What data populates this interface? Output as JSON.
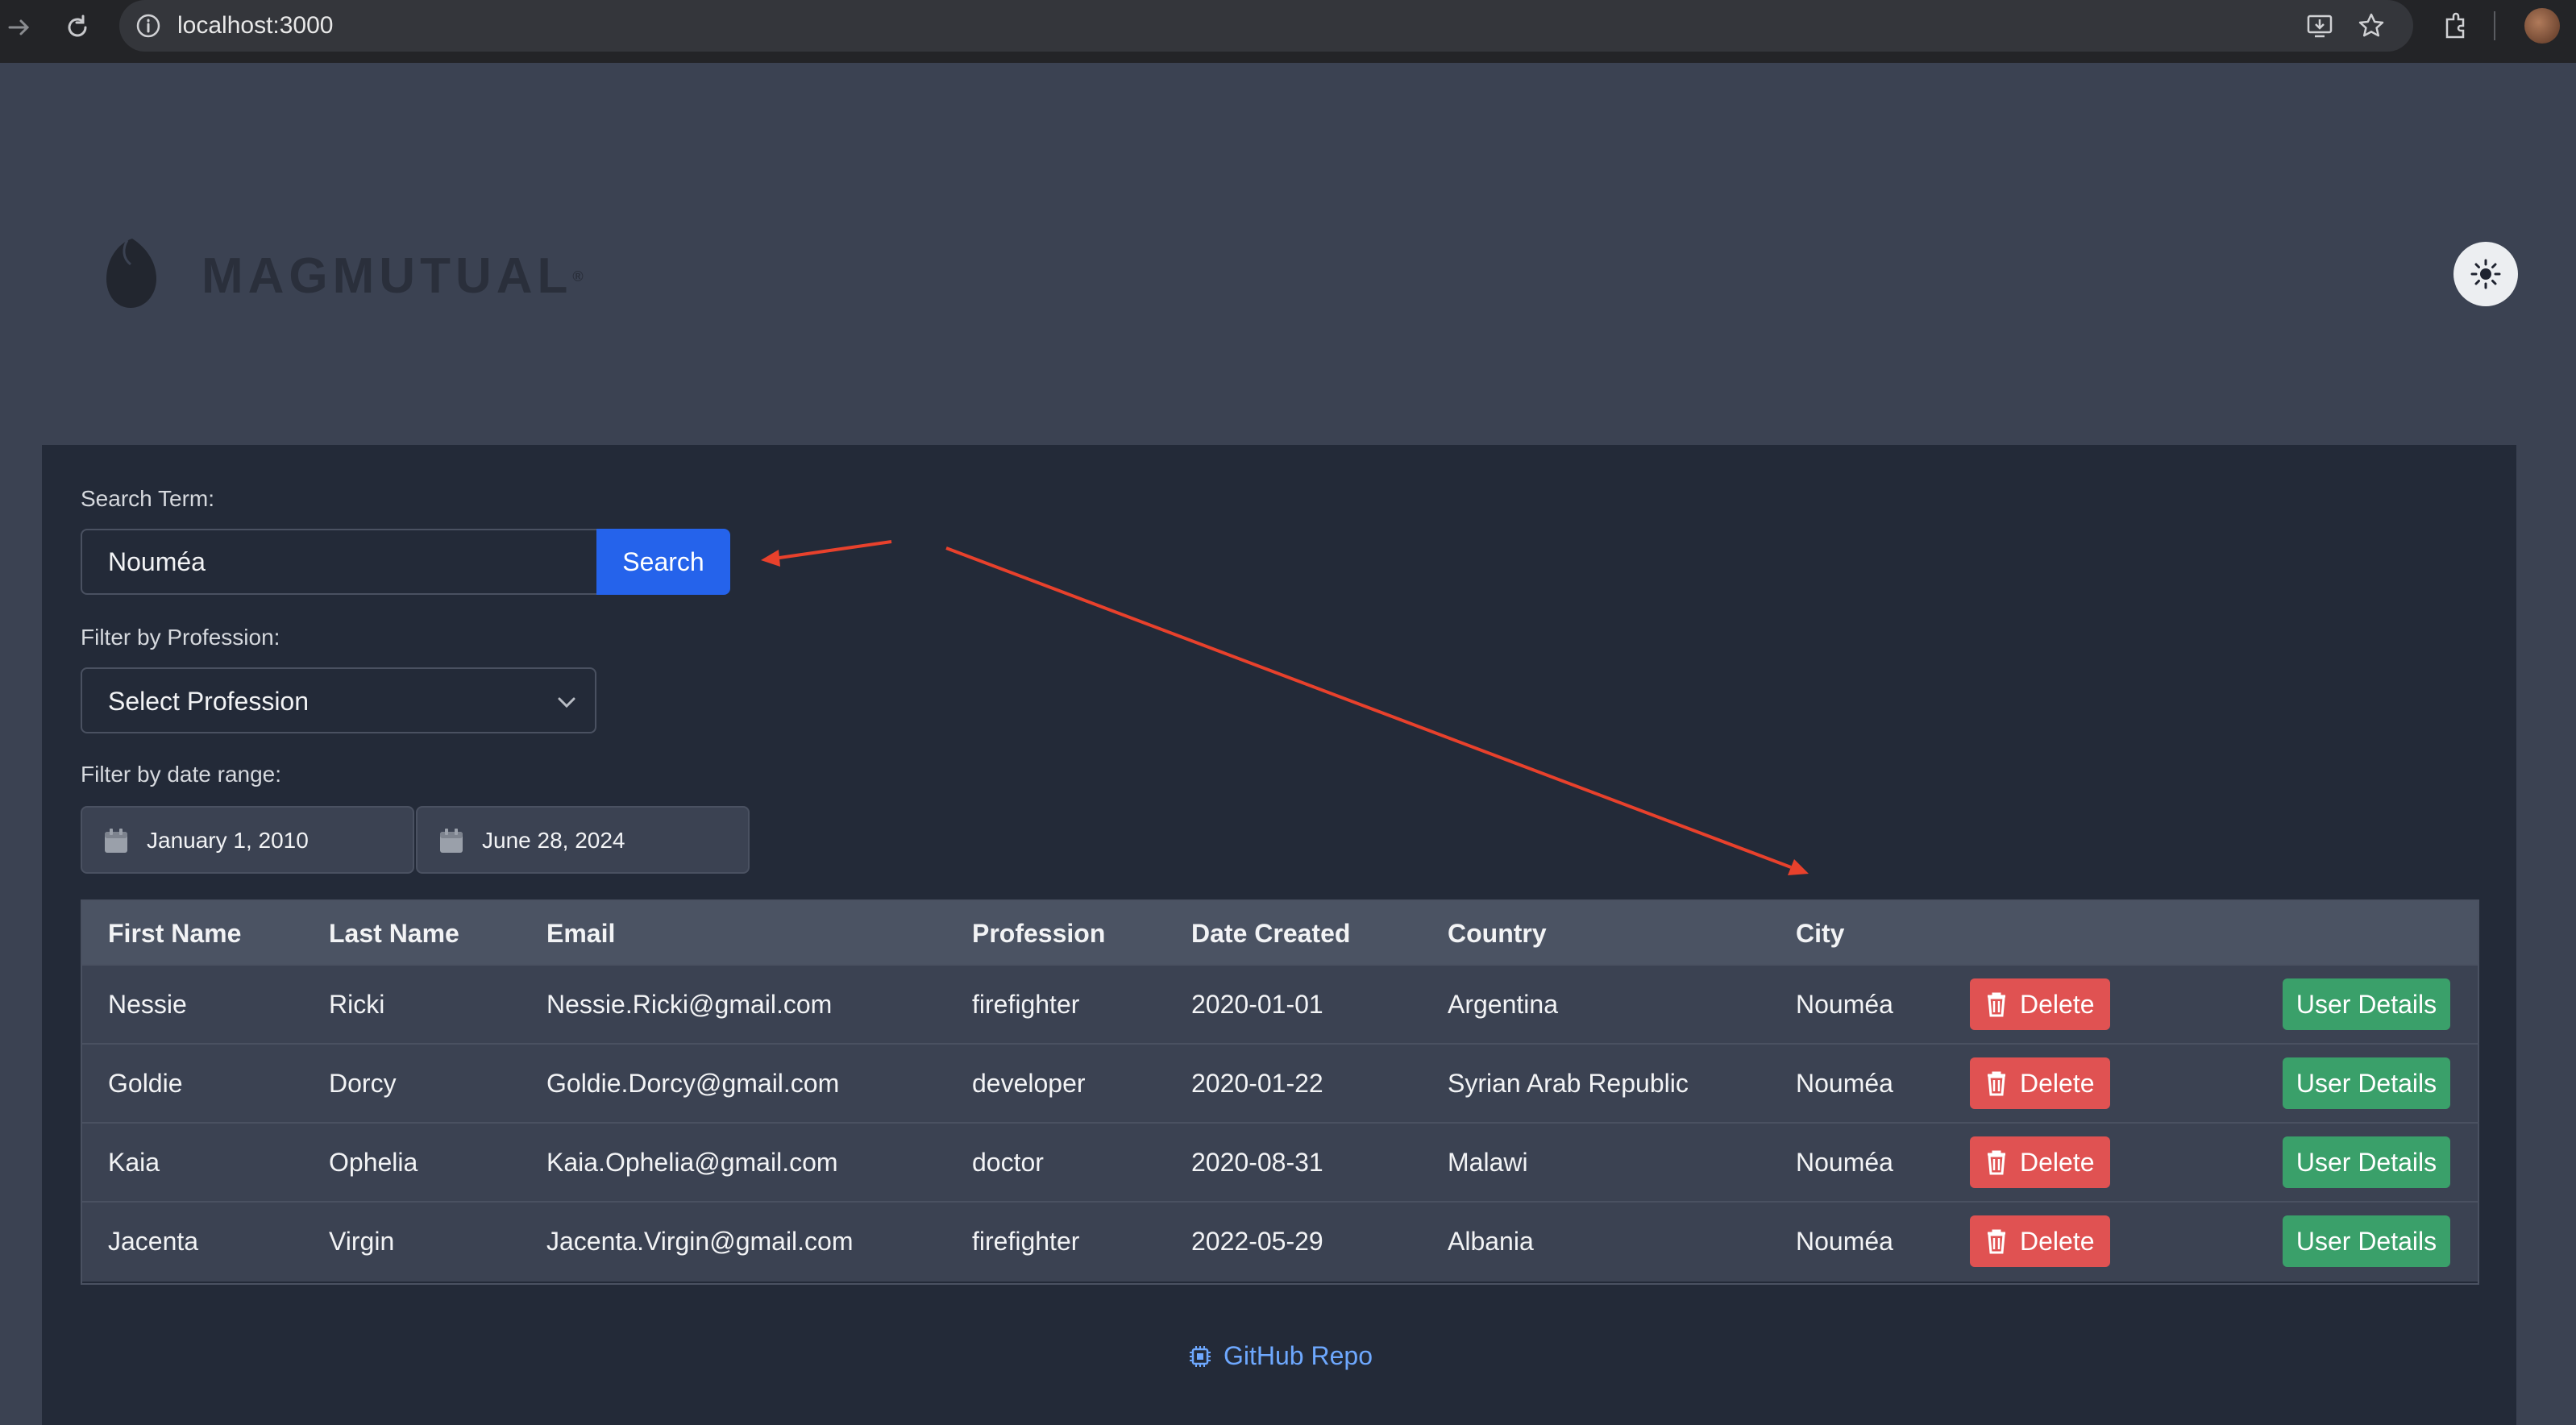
{
  "browser": {
    "url": "localhost:3000"
  },
  "header": {
    "logo_text": "MAGMUTUAL",
    "logo_reg": "®",
    "theme_toggle_icon": "sun-icon"
  },
  "search": {
    "label": "Search Term:",
    "value": "Nouméa",
    "button_label": "Search"
  },
  "profession_filter": {
    "label": "Filter by Profession:",
    "selected": "Select Profession"
  },
  "date_filter": {
    "label": "Filter by date range:",
    "start": "January 1, 2010",
    "end": "June 28, 2024"
  },
  "table": {
    "headers": [
      "First Name",
      "Last Name",
      "Email",
      "Profession",
      "Date Created",
      "Country",
      "City"
    ],
    "delete_label": "Delete",
    "details_label": "User Details",
    "rows": [
      {
        "first": "Nessie",
        "last": "Ricki",
        "email": "Nessie.Ricki@gmail.com",
        "profession": "firefighter",
        "date": "2020-01-01",
        "country": "Argentina",
        "city": "Nouméa"
      },
      {
        "first": "Goldie",
        "last": "Dorcy",
        "email": "Goldie.Dorcy@gmail.com",
        "profession": "developer",
        "date": "2020-01-22",
        "country": "Syrian Arab Republic",
        "city": "Nouméa"
      },
      {
        "first": "Kaia",
        "last": "Ophelia",
        "email": "Kaia.Ophelia@gmail.com",
        "profession": "doctor",
        "date": "2020-08-31",
        "country": "Malawi",
        "city": "Nouméa"
      },
      {
        "first": "Jacenta",
        "last": "Virgin",
        "email": "Jacenta.Virgin@gmail.com",
        "profession": "firefighter",
        "date": "2022-05-29",
        "country": "Albania",
        "city": "Nouméa"
      }
    ]
  },
  "footer": {
    "github_label": "GitHub Repo"
  },
  "colors": {
    "page_bg": "#3b4252",
    "panel_bg": "#232a38",
    "primary": "#2563eb",
    "danger": "#e05252",
    "success": "#3aa06a",
    "annotation": "#e8412c"
  }
}
